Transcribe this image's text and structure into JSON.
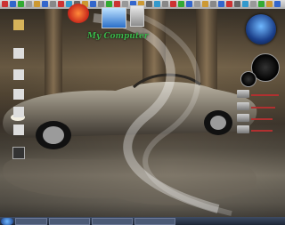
{
  "desktop_icons": [
    {
      "label": "",
      "name": "folder-icon"
    },
    {
      "label": "",
      "name": "document-icon"
    },
    {
      "label": "",
      "name": "document-icon"
    },
    {
      "label": "",
      "name": "document-icon"
    },
    {
      "label": "",
      "name": "document-icon"
    },
    {
      "label": "",
      "name": "document-icon"
    },
    {
      "label": "",
      "name": "application-icon"
    }
  ],
  "my_computer": {
    "label": "My Computer"
  },
  "drives": [
    {
      "label": "",
      "fill": 0.9
    },
    {
      "label": "",
      "fill": 0.8
    },
    {
      "label": "",
      "fill": 0.7
    },
    {
      "label": "",
      "fill": 0.7
    }
  ],
  "blog_url": "",
  "taskbar": {
    "tasks": [
      "",
      "",
      "",
      ""
    ],
    "clock": ""
  },
  "colors": {
    "my_computer_text": "#3ab54a",
    "orb": "#1b3f89"
  }
}
